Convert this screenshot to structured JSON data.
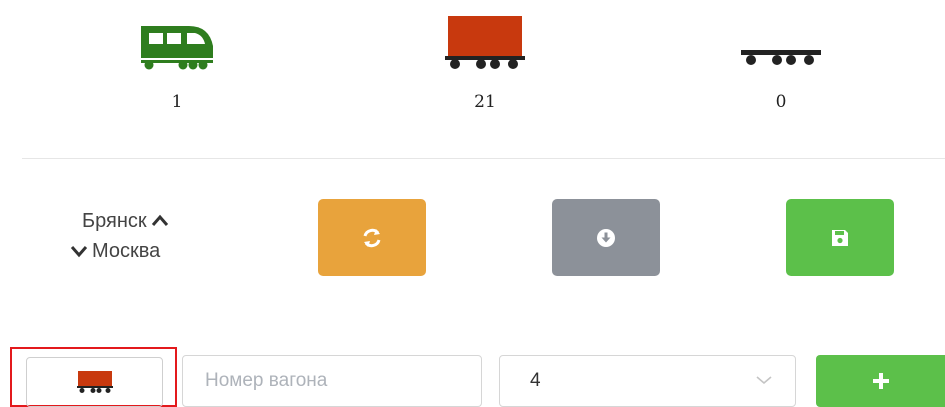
{
  "stats": [
    {
      "icon": "locomotive-icon",
      "count": "1",
      "color": "#2e7d1e"
    },
    {
      "icon": "freight-wagon-icon",
      "count": "21",
      "color": "#c8390e"
    },
    {
      "icon": "flatcar-icon",
      "count": "0",
      "color": "#222222"
    }
  ],
  "route": {
    "from": "Брянск",
    "to": "Москва",
    "swap_up_icon": "chevron-up-icon",
    "swap_down_icon": "chevron-down-icon"
  },
  "actions": {
    "refresh": {
      "icon": "refresh-icon",
      "color": "#e8a33c"
    },
    "download": {
      "icon": "download-icon",
      "color": "#8c9199"
    },
    "save": {
      "icon": "save-icon",
      "color": "#5cc04a"
    }
  },
  "add_row": {
    "type_icon": "freight-wagon-icon",
    "wagon_number_placeholder": "Номер вагона",
    "wagon_number_value": "",
    "quantity_value": "4",
    "add_icon": "plus-icon",
    "add_color": "#5cc04a"
  }
}
